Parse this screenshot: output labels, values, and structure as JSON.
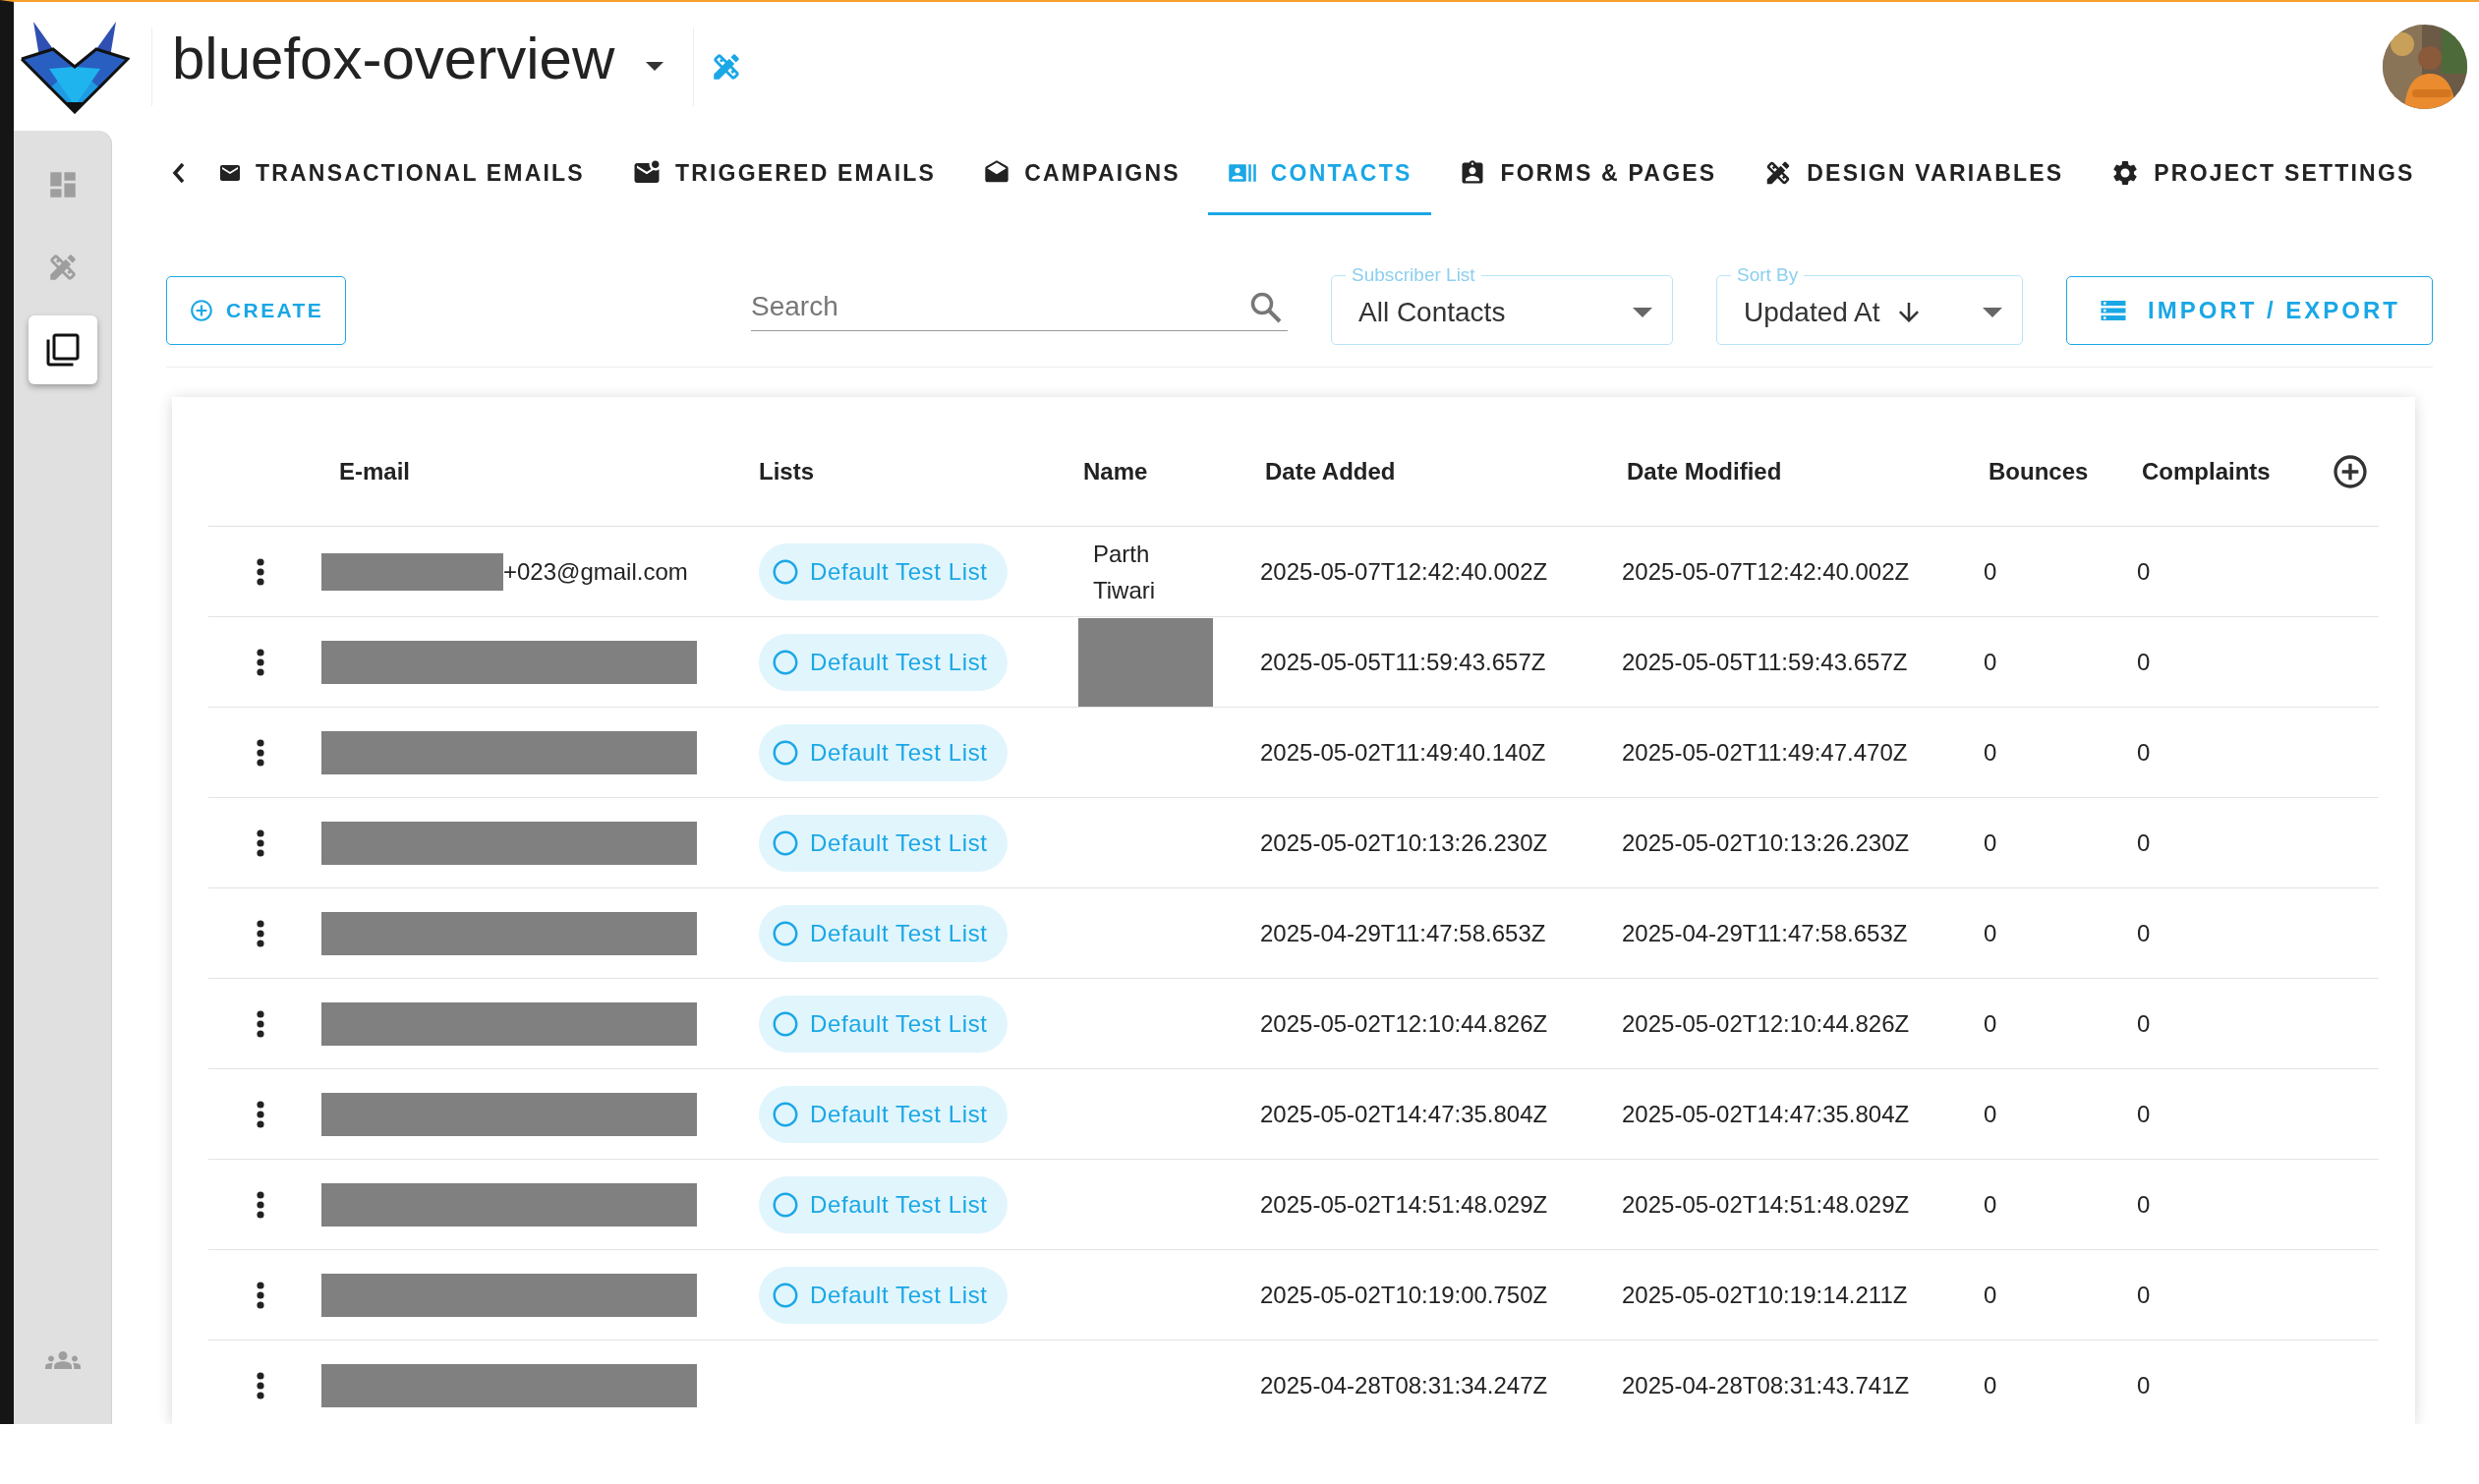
{
  "project": {
    "title": "bluefox-overview"
  },
  "sidebar": {
    "items": [
      {
        "kind": "dashboard",
        "selected": false
      },
      {
        "kind": "tools",
        "selected": false
      },
      {
        "kind": "library",
        "selected": true
      },
      {
        "kind": "team",
        "selected": false
      }
    ]
  },
  "nav_tabs": [
    {
      "label": "TRANSACTIONAL EMAILS",
      "kind": "mail",
      "selected": false
    },
    {
      "label": "TRIGGERED EMAILS",
      "kind": "mail-alert",
      "selected": false
    },
    {
      "label": "CAMPAIGNS",
      "kind": "campaign",
      "selected": false
    },
    {
      "label": "CONTACTS",
      "kind": "contacts",
      "selected": true
    },
    {
      "label": "FORMS & PAGES",
      "kind": "forms",
      "selected": false
    },
    {
      "label": "DESIGN VARIABLES",
      "kind": "design",
      "selected": false
    },
    {
      "label": "PROJECT SETTINGS",
      "kind": "settings",
      "selected": false
    }
  ],
  "toolbar": {
    "create_button": "CREATE",
    "search": {
      "placeholder": "Search"
    },
    "subscriber_list": {
      "label": "Subscriber List",
      "value": "All Contacts"
    },
    "sort_by": {
      "label": "Sort By",
      "value": "Updated At"
    },
    "import_export_button": "IMPORT / EXPORT"
  },
  "table": {
    "columns": [
      "E-mail",
      "Lists",
      "Name",
      "Date Added",
      "Date Modified",
      "Bounces",
      "Complaints"
    ],
    "rows": [
      {
        "email": "+023@gmail.com",
        "email_redacted": true,
        "list": "Default Test List",
        "name": "Parth Tiwari",
        "name_redacted": false,
        "date_added": "2025-05-07T12:42:40.002Z",
        "date_modified": "2025-05-07T12:42:40.002Z",
        "bounces": "0",
        "complaints": "0"
      },
      {
        "email_redacted": true,
        "list": "Default Test List",
        "name_redacted": true,
        "date_added": "2025-05-05T11:59:43.657Z",
        "date_modified": "2025-05-05T11:59:43.657Z",
        "bounces": "0",
        "complaints": "0"
      },
      {
        "email_redacted": true,
        "list": "Default Test List",
        "name_redacted": false,
        "date_added": "2025-05-02T11:49:40.140Z",
        "date_modified": "2025-05-02T11:49:47.470Z",
        "bounces": "0",
        "complaints": "0"
      },
      {
        "email_redacted": true,
        "list": "Default Test List",
        "name_redacted": false,
        "date_added": "2025-05-02T10:13:26.230Z",
        "date_modified": "2025-05-02T10:13:26.230Z",
        "bounces": "0",
        "complaints": "0"
      },
      {
        "email_redacted": true,
        "list": "Default Test List",
        "name_redacted": false,
        "date_added": "2025-04-29T11:47:58.653Z",
        "date_modified": "2025-04-29T11:47:58.653Z",
        "bounces": "0",
        "complaints": "0"
      },
      {
        "email_redacted": true,
        "list": "Default Test List",
        "name_redacted": false,
        "date_added": "2025-05-02T12:10:44.826Z",
        "date_modified": "2025-05-02T12:10:44.826Z",
        "bounces": "0",
        "complaints": "0"
      },
      {
        "email_redacted": true,
        "list": "Default Test List",
        "name_redacted": false,
        "date_added": "2025-05-02T14:47:35.804Z",
        "date_modified": "2025-05-02T14:47:35.804Z",
        "bounces": "0",
        "complaints": "0"
      },
      {
        "email_redacted": true,
        "list": "Default Test List",
        "name_redacted": false,
        "date_added": "2025-05-02T14:51:48.029Z",
        "date_modified": "2025-05-02T14:51:48.029Z",
        "bounces": "0",
        "complaints": "0"
      },
      {
        "email_redacted": true,
        "list": "Default Test List",
        "name_redacted": false,
        "date_added": "2025-05-02T10:19:00.750Z",
        "date_modified": "2025-05-02T10:19:14.211Z",
        "bounces": "0",
        "complaints": "0"
      },
      {
        "email_redacted": true,
        "name_redacted": false,
        "date_added": "2025-04-28T08:31:34.247Z",
        "date_modified": "2025-04-28T08:31:43.741Z",
        "bounces": "0",
        "complaints": "0"
      }
    ]
  }
}
